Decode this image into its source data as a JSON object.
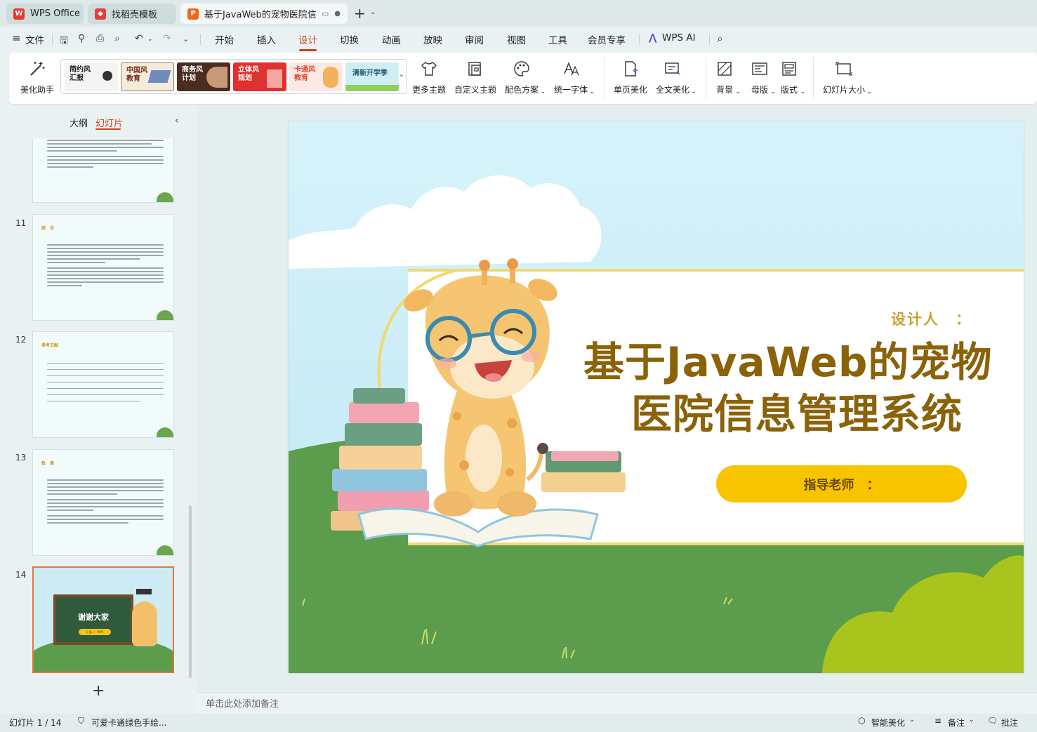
{
  "tabs": [
    {
      "label": "WPS Office",
      "logo": "W"
    },
    {
      "label": "找稻壳模板",
      "logo": "◆"
    },
    {
      "label": "基于JavaWeb的宠物医院信息",
      "logo": "P"
    }
  ],
  "menu": {
    "file": "文件",
    "items": [
      "开始",
      "插入",
      "设计",
      "切换",
      "动画",
      "放映",
      "审阅",
      "视图",
      "工具",
      "会员专享"
    ],
    "active": "设计",
    "ai": "WPS AI"
  },
  "ribbon": {
    "beautify": "美化助手",
    "themes": [
      {
        "label": "简约风\n汇报"
      },
      {
        "label": "中国风\n教育"
      },
      {
        "label": "商务风\n计划"
      },
      {
        "label": "立体风\n规划"
      },
      {
        "label": "卡通风\n教育"
      },
      {
        "label": "清新开学季"
      }
    ],
    "more_themes": "更多主题",
    "custom_theme": "自定义主题",
    "color_scheme": "配色方案",
    "font": "统一字体",
    "page_beautify": "单页美化",
    "full_beautify": "全文美化",
    "background": "背景",
    "master": "母版",
    "layout": "版式",
    "slide_size": "幻灯片大小"
  },
  "panel": {
    "outline": "大纲",
    "slides": "幻灯片",
    "thumbs": [
      {
        "num": "11",
        "title": "结　论"
      },
      {
        "num": "12",
        "title": "参考文献"
      },
      {
        "num": "13",
        "title": "致　谢"
      },
      {
        "num": "14",
        "title": "谢谢大家",
        "sub": "汇报人：WPS"
      }
    ],
    "add": "+"
  },
  "slide": {
    "designer": "设计人　：",
    "title_line1": "基于JavaWeb的宠物",
    "title_line2": "医院信息管理系统",
    "advisor": "指导老师　："
  },
  "notes": {
    "placeholder": "单击此处添加备注"
  },
  "status": {
    "page": "幻灯片 1 / 14",
    "theme": "可爱卡通绿色手绘...",
    "smart": "智能美化",
    "notes": "备注",
    "comments": "批注"
  },
  "colors": {
    "accent": "#c8441a",
    "title": "#8a6208",
    "yellow": "#f8c400",
    "grass": "#5b9c4d",
    "lime": "#a9c41c"
  }
}
